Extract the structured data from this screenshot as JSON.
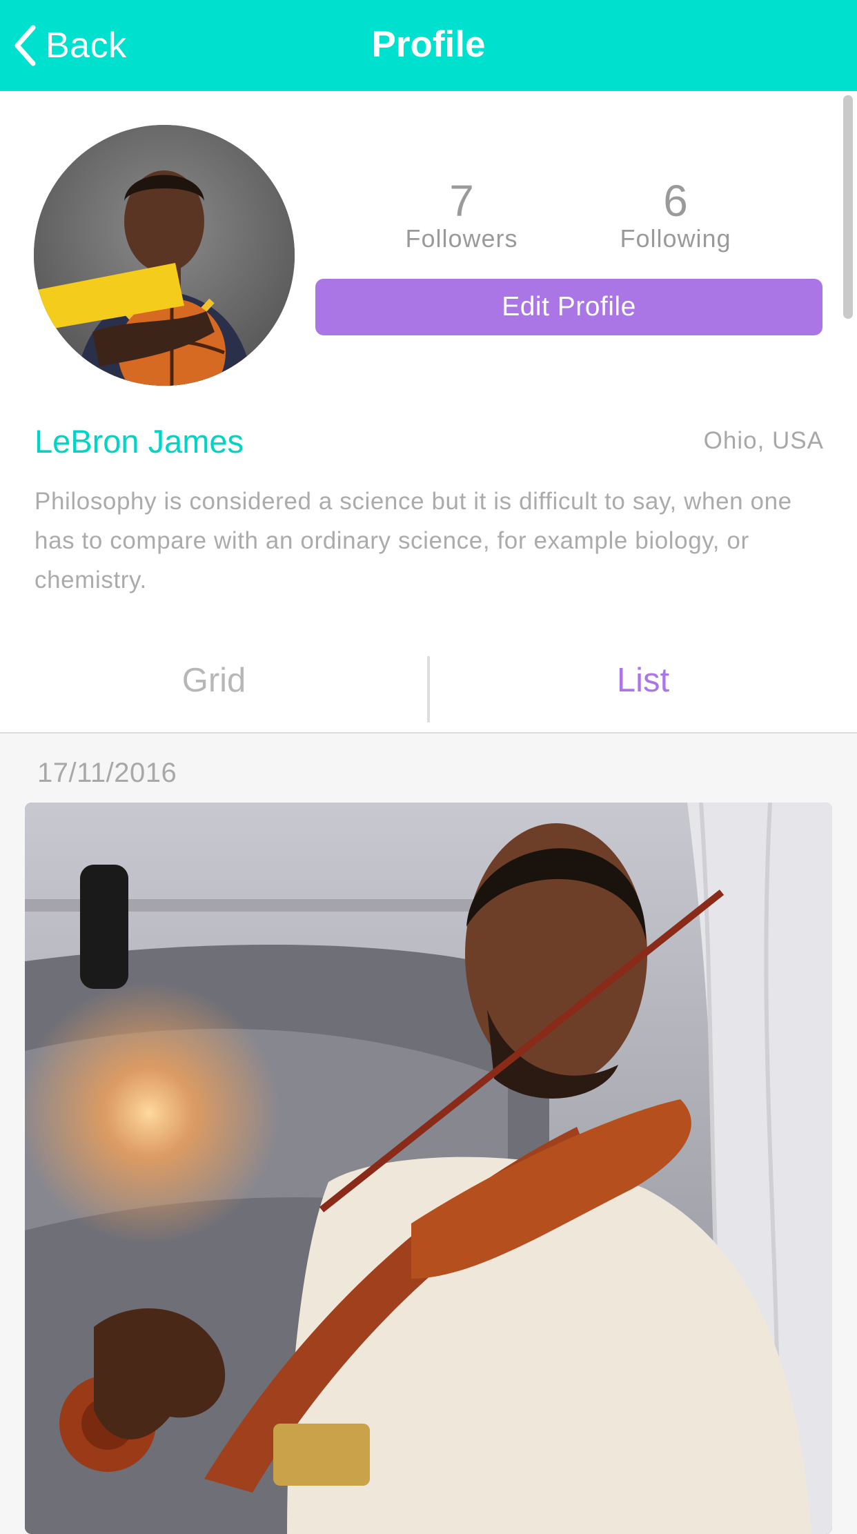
{
  "header": {
    "back_label": "Back",
    "title": "Profile",
    "bg_color": "#00e0cf"
  },
  "profile": {
    "followers_count": "7",
    "followers_label": "Followers",
    "following_count": "6",
    "following_label": "Following",
    "edit_button_label": "Edit Profile",
    "name": "LeBron James",
    "location": "Ohio, USA",
    "bio": "Philosophy is considered a science but it is difficult to say, when one has to compare with an ordinary science, for example biology, or chemistry.",
    "accent_color": "#aa76e6",
    "name_color": "#00d4c4"
  },
  "tabs": {
    "grid_label": "Grid",
    "list_label": "List",
    "active": "List"
  },
  "feed": {
    "posts": [
      {
        "date": "17/11/2016"
      }
    ]
  }
}
